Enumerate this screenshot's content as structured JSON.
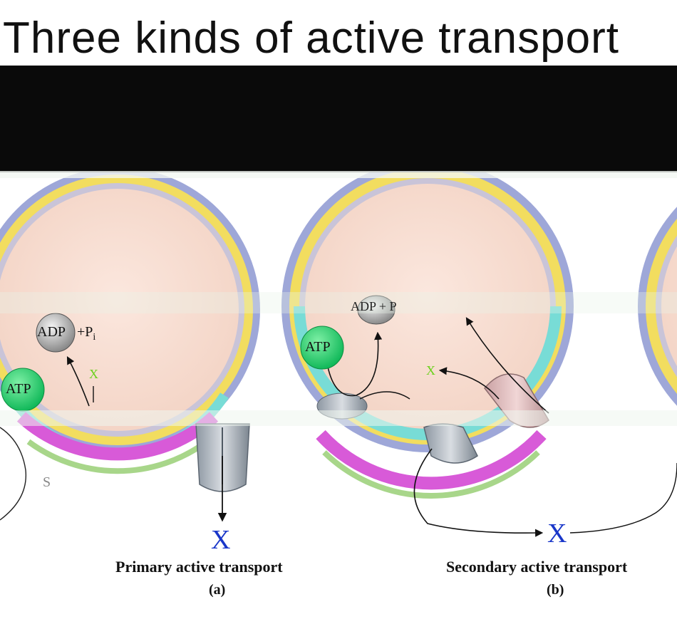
{
  "title": {
    "text": "Three kinds of active transport"
  },
  "panel_a": {
    "adp_label": "ADP",
    "pi_label": "+P",
    "pi_sub": "i",
    "atp_label": "ATP",
    "x_inside": "X",
    "s_label": "S",
    "x_outside": "X",
    "caption": "Primary active transport",
    "letter": "(a)"
  },
  "panel_b": {
    "adp_label": "ADP + P",
    "atp_label": "ATP",
    "x_inside": "X",
    "x_outside": "X",
    "caption": "Secondary active transport",
    "letter": "(b)"
  },
  "colors": {
    "outer_ring": "#9ea7d8",
    "yellow_layer": "#f2dd5f",
    "cytoplasm": "#f6dcd0",
    "cyan_layer": "#78dcd6",
    "magenta_layer": "#d85ad8",
    "green_layer": "#a8d68a",
    "atp_green": "#22d56f",
    "x_green": "#6bd11d",
    "x_blue": "#1936c9"
  }
}
